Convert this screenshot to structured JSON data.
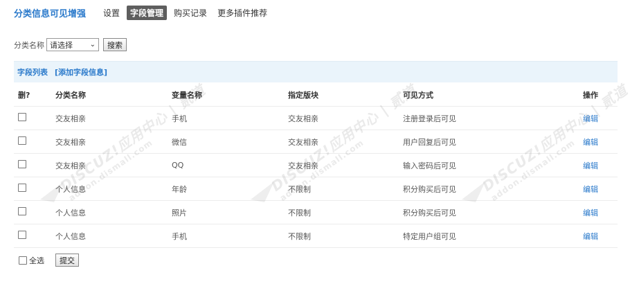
{
  "brand": "分类信息可见增强",
  "nav": [
    {
      "label": "设置",
      "active": false
    },
    {
      "label": "字段管理",
      "active": true
    },
    {
      "label": "购买记录",
      "active": false
    },
    {
      "label": "更多插件推荐",
      "active": false
    }
  ],
  "filter": {
    "label": "分类名称",
    "select_value": "请选择",
    "search_button": "搜索"
  },
  "panel": {
    "title": "字段列表",
    "add_link": "[添加字段信息]"
  },
  "table": {
    "columns": {
      "delete": "删?",
      "category": "分类名称",
      "variable": "变量名称",
      "block": "指定版块",
      "visibility": "可见方式",
      "action": "操作"
    },
    "rows": [
      {
        "category": "交友相亲",
        "variable": "手机",
        "block": "交友相亲",
        "visibility": "注册登录后可见",
        "action": "编辑"
      },
      {
        "category": "交友相亲",
        "variable": "微信",
        "block": "交友相亲",
        "visibility": "用户回复后可见",
        "action": "编辑"
      },
      {
        "category": "交友相亲",
        "variable": "QQ",
        "block": "交友相亲",
        "visibility": "输入密码后可见",
        "action": "编辑"
      },
      {
        "category": "个人信息",
        "variable": "年龄",
        "block": "不限制",
        "visibility": "积分购买后可见",
        "action": "编辑"
      },
      {
        "category": "个人信息",
        "variable": "照片",
        "block": "不限制",
        "visibility": "积分购买后可见",
        "action": "编辑"
      },
      {
        "category": "个人信息",
        "variable": "手机",
        "block": "不限制",
        "visibility": "特定用户组可见",
        "action": "编辑"
      }
    ]
  },
  "footer": {
    "select_all": "全选",
    "submit": "提交"
  },
  "watermark": {
    "line1": "DISCUZ!应用中心 | 贰道",
    "line2": "addon.dismall.com"
  },
  "colors": {
    "accent": "#2b7acb",
    "nav_active_bg": "#5e5e5e",
    "panel_bg": "#eaf4fb"
  }
}
